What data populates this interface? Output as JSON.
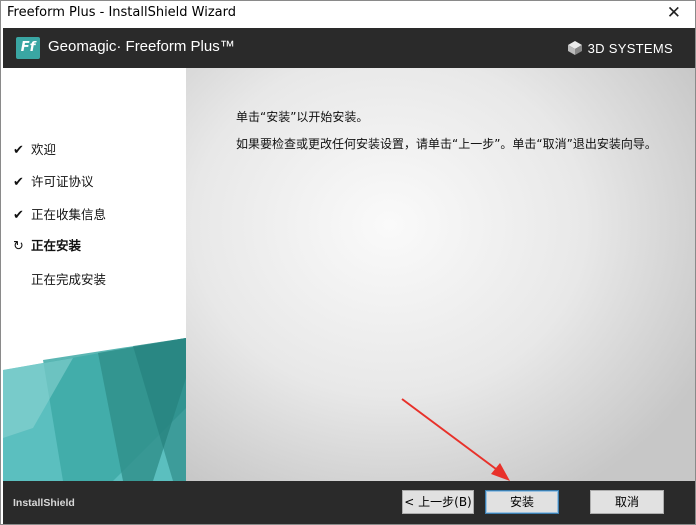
{
  "window": {
    "title": "Freeform Plus - InstallShield Wizard",
    "close_glyph": "✕"
  },
  "header": {
    "logo_text": "Ff",
    "product_name": "Geomagic· Freeform Plus™",
    "vendor": "3D SYSTEMS",
    "colors": {
      "header_bg": "#2a2a2a",
      "logo_bg": "#3aa6a3"
    }
  },
  "steps": [
    {
      "label": "欢迎",
      "status": "done",
      "icon": "check-icon",
      "glyph": "✔"
    },
    {
      "label": "许可证协议",
      "status": "done",
      "icon": "check-icon",
      "glyph": "✔"
    },
    {
      "label": "正在收集信息",
      "status": "done",
      "icon": "check-icon",
      "glyph": "✔"
    },
    {
      "label": "正在安装",
      "status": "current",
      "icon": "progress-icon",
      "glyph": "↻"
    },
    {
      "label": "正在完成安装",
      "status": "pending",
      "icon": "",
      "glyph": ""
    }
  ],
  "main": {
    "line1": "单击“安装”以开始安装。",
    "line2": "如果要检查或更改任何安装设置，请单击“上一步”。单击“取消”退出安装向导。"
  },
  "footer": {
    "brand": "InstallShield",
    "back_label": "< 上一步(B)",
    "install_label": "安装",
    "cancel_label": "取消"
  },
  "annotation": {
    "color": "#e8312a"
  }
}
